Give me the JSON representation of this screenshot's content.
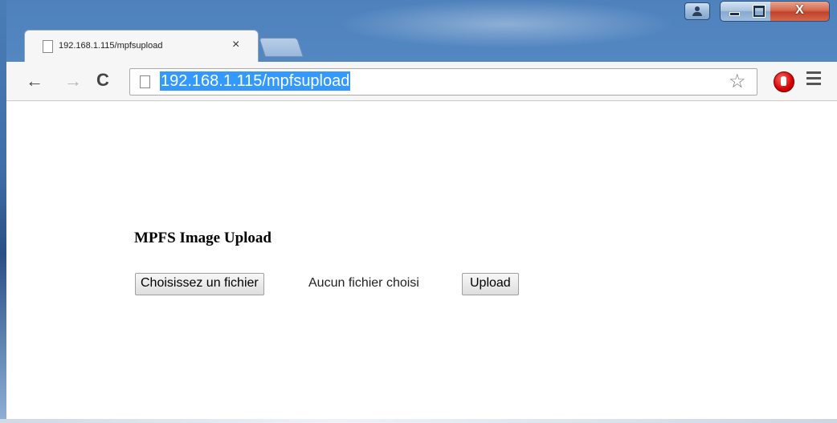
{
  "window": {
    "controls": {
      "close_glyph": "X"
    }
  },
  "tab": {
    "title": "192.168.1.115/mpfsupload",
    "close_glyph": "×"
  },
  "toolbar": {
    "back_glyph": "←",
    "forward_glyph": "→",
    "reload_glyph": "C",
    "url": "192.168.1.115/mpfsupload",
    "star_glyph": "☆"
  },
  "page": {
    "heading": "MPFS Image Upload",
    "file_button_label": "Choisissez un fichier",
    "file_status": "Aucun fichier choisi",
    "upload_button_label": "Upload"
  },
  "icons": {
    "tab_favicon": "page-icon",
    "extension": "stop-hand-icon",
    "menu": "hamburger-menu-icon"
  },
  "colors": {
    "url_selection": "#3399ff",
    "extension_red": "#d60000",
    "close_button": "#c0432a"
  }
}
